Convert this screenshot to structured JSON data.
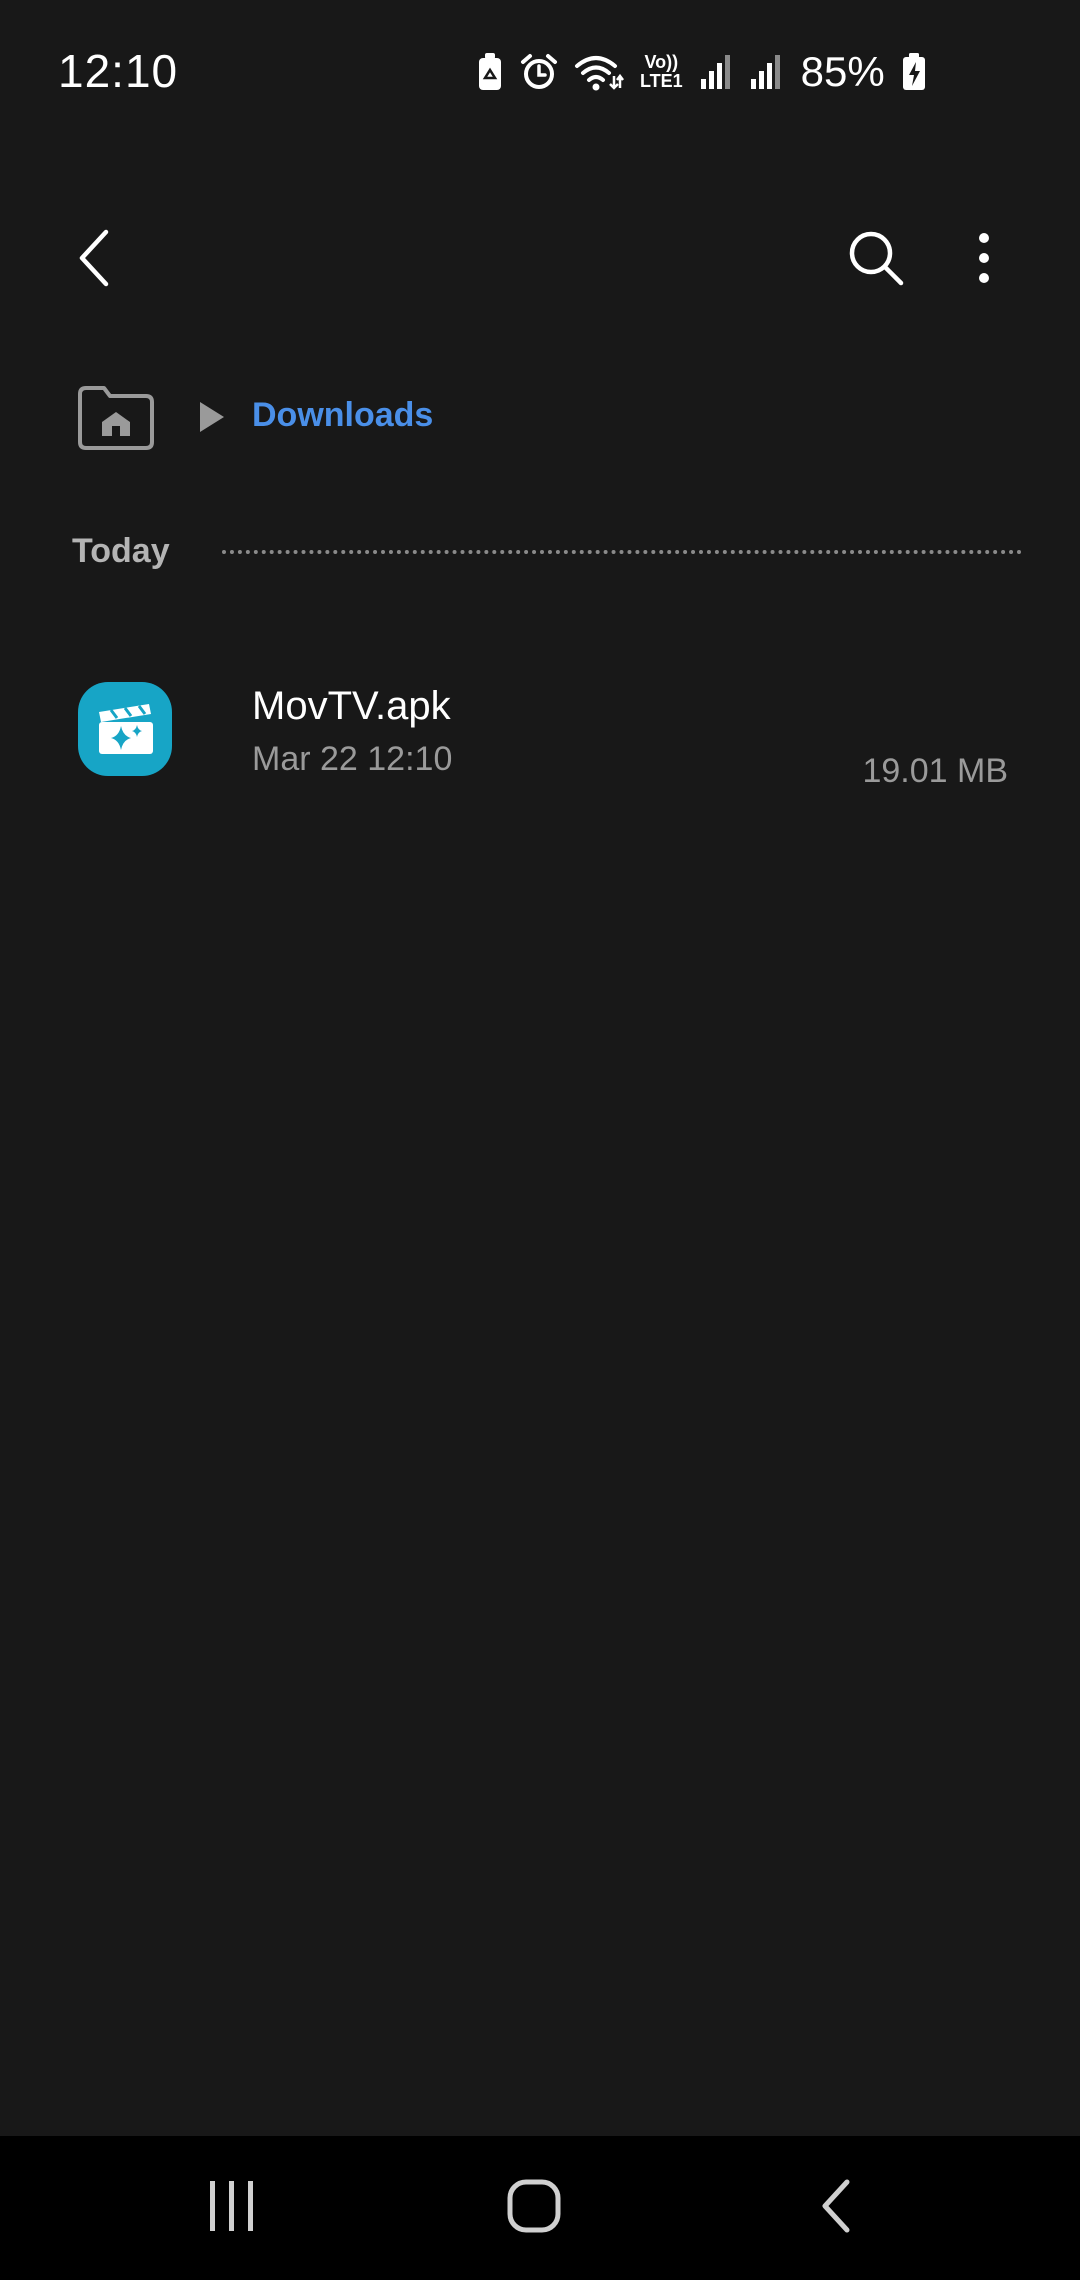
{
  "status_bar": {
    "time": "12:10",
    "battery_percent": "85%",
    "network_label_top": "Vo))",
    "network_label_bottom": "LTE1",
    "icons": [
      "battery-saver-icon",
      "alarm-icon",
      "wifi-icon",
      "volte-icon",
      "signal-sim1-icon",
      "signal-sim2-icon",
      "battery-charging-icon"
    ]
  },
  "app_bar": {
    "back_icon": "back-arrow-icon",
    "search_icon": "search-icon",
    "menu_icon": "more-options-icon"
  },
  "breadcrumb": {
    "home_icon": "home-folder-icon",
    "separator_icon": "play-arrow-icon",
    "current": "Downloads"
  },
  "section": {
    "title": "Today"
  },
  "files": [
    {
      "name": "MovTV.apk",
      "date": "Mar 22 12:10",
      "size": "19.01 MB",
      "icon": "video-editor-app-icon"
    }
  ],
  "nav_bar": {
    "icons": [
      "recents-icon",
      "home-icon",
      "back-icon"
    ]
  },
  "colors": {
    "background": "#181818",
    "accent": "#4a8fe8",
    "app_icon": "#17a5c6",
    "secondary_text": "#9a9a9a"
  }
}
